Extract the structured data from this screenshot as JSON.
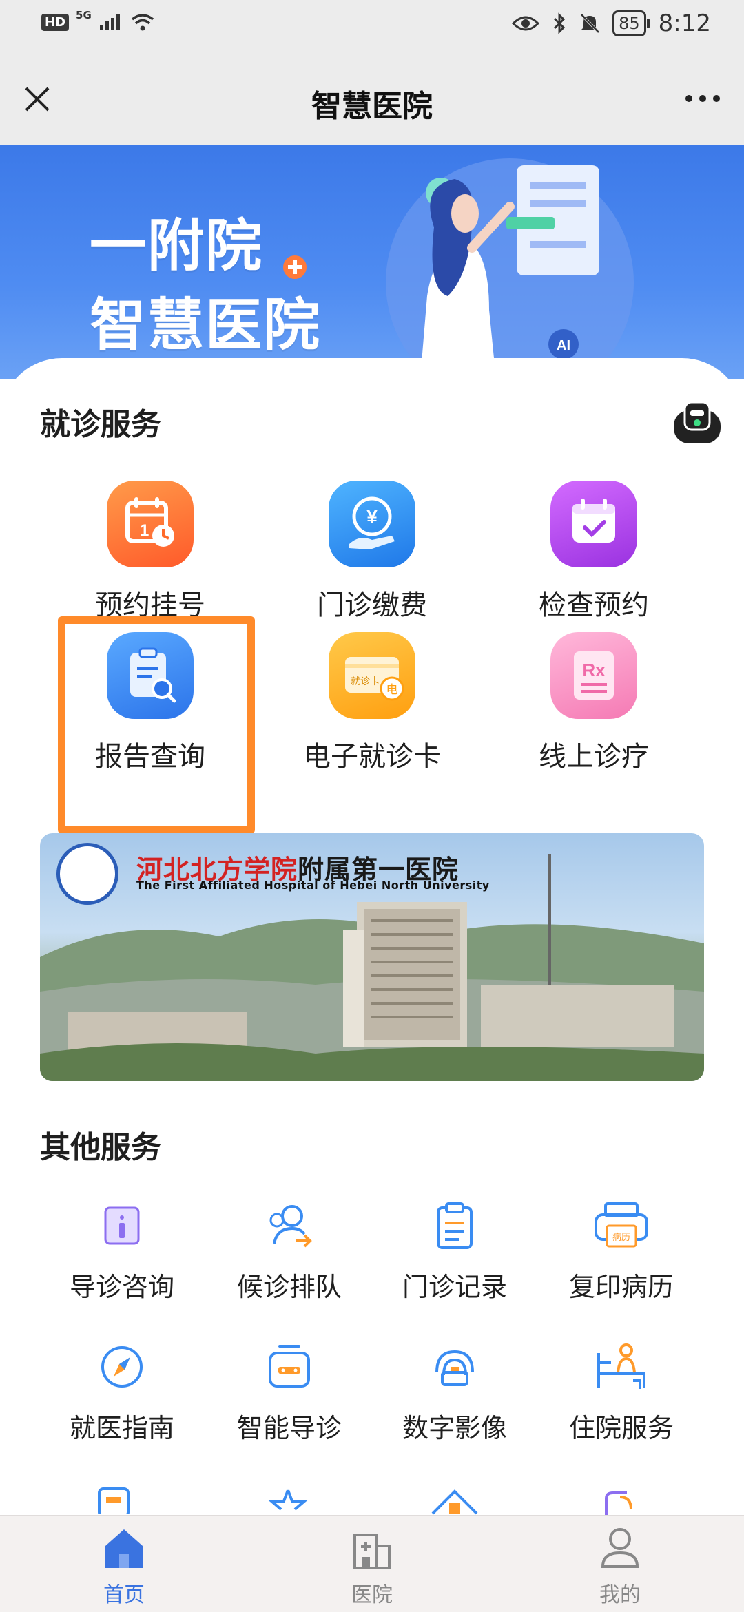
{
  "status_bar": {
    "hd": "HD",
    "network": "5G",
    "battery": "85",
    "time": "8:12"
  },
  "header": {
    "title": "智慧医院"
  },
  "banner": {
    "line1": "一附院",
    "line2": "智慧医院",
    "ai_badge": "AI"
  },
  "medical_services": {
    "title": "就诊服务",
    "items": [
      {
        "label": "预约挂号",
        "icon": "calendar-clock-icon",
        "color": "#ff6f3c"
      },
      {
        "label": "门诊缴费",
        "icon": "yuan-payment-icon",
        "color": "#2f8ef0"
      },
      {
        "label": "检查预约",
        "icon": "calendar-check-icon",
        "color": "#b347e8"
      },
      {
        "label": "报告查询",
        "icon": "report-search-icon",
        "color": "#3a8cf2",
        "highlighted": true
      },
      {
        "label": "电子就诊卡",
        "icon": "medical-card-icon",
        "color": "#ffb11f",
        "card_text": "就诊卡",
        "card_badge": "电"
      },
      {
        "label": "线上诊疗",
        "icon": "prescription-icon",
        "color": "#f79ac4",
        "rx": "Rx"
      }
    ]
  },
  "hospital_banner": {
    "name_script": "河北北方学院",
    "name_bold": "附属第一医院",
    "name_en": "The First Affiliated Hospital of Hebei North University"
  },
  "other_services": {
    "title": "其他服务",
    "items": [
      {
        "label": "导诊咨询",
        "icon": "info-icon"
      },
      {
        "label": "候诊排队",
        "icon": "queue-icon"
      },
      {
        "label": "门诊记录",
        "icon": "clipboard-icon"
      },
      {
        "label": "复印病历",
        "icon": "printer-icon",
        "badge": "病历"
      },
      {
        "label": "就医指南",
        "icon": "compass-icon"
      },
      {
        "label": "智能导诊",
        "icon": "robot-guide-icon"
      },
      {
        "label": "数字影像",
        "icon": "imaging-icon"
      },
      {
        "label": "住院服务",
        "icon": "inpatient-icon"
      }
    ]
  },
  "bottom_nav": [
    {
      "label": "首页",
      "icon": "home-icon",
      "active": true
    },
    {
      "label": "医院",
      "icon": "hospital-icon",
      "active": false
    },
    {
      "label": "我的",
      "icon": "profile-icon",
      "active": false
    }
  ],
  "colors": {
    "primary": "#3a73e0",
    "highlight": "#ff8a2a",
    "header_bg": "#ececec"
  }
}
